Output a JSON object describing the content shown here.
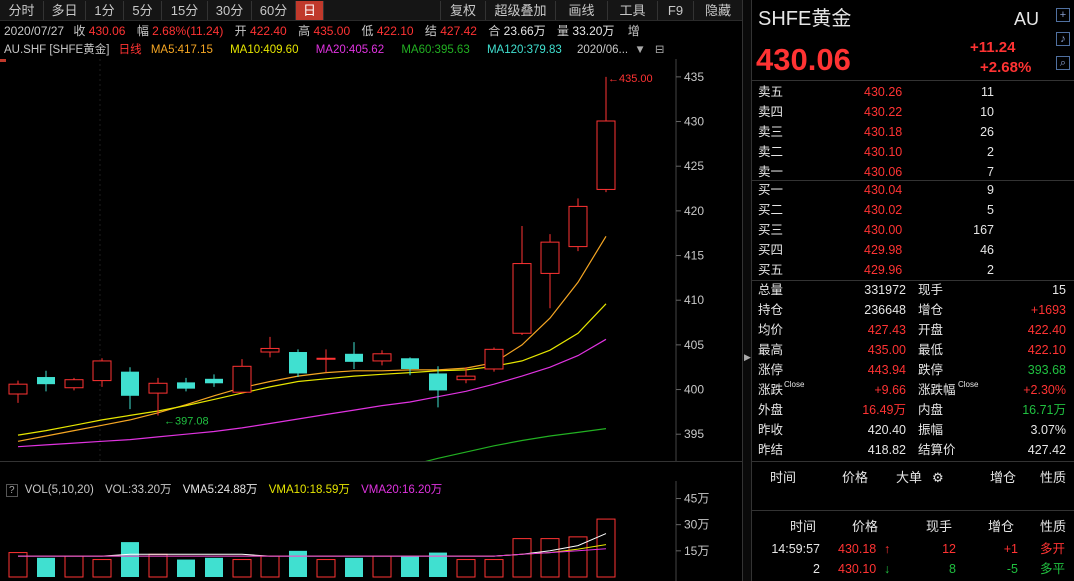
{
  "toolbar": {
    "periods": [
      "分时",
      "多日",
      "1分",
      "5分",
      "15分",
      "30分",
      "60分",
      "日"
    ],
    "active_period": "日",
    "actions": [
      "复权",
      "超级叠加",
      "画线",
      "工具",
      "F9",
      "隐藏"
    ]
  },
  "quote_line": {
    "date": "2020/07/27",
    "close_label": "收",
    "close": "430.06",
    "range_label": "幅",
    "range": "2.68%(11.24)",
    "open_label": "开",
    "open": "422.40",
    "high_label": "高",
    "high": "435.00",
    "low_label": "低",
    "low": "422.10",
    "settle_label": "结",
    "settle": "427.42",
    "oi_label": "合",
    "oi": "23.66万",
    "vol_label": "量",
    "vol": "33.20万",
    "more": "增"
  },
  "ma_line": {
    "symbol": "AU.SHF [SHFE黄金]",
    "period": "日线",
    "ma5": "MA5:417.15",
    "ma10": "MA10:409.60",
    "ma20": "MA20:405.62",
    "ma60": "MA60:395.63",
    "ma120": "MA120:379.83",
    "date_dropdown": "2020/06..."
  },
  "chart_data": [
    {
      "type": "candlestick",
      "title": "",
      "y_ticks": [
        "435",
        "430",
        "425",
        "420",
        "415",
        "410",
        "405",
        "400",
        "395"
      ],
      "ylim": [
        392,
        437
      ],
      "up_color": "#ff3333",
      "down_color": "#40e0d0",
      "annotations": {
        "max": "435.00",
        "min": "397.08"
      },
      "candles": [
        {
          "o": 399.5,
          "h": 401,
          "l": 398.5,
          "c": 400.6
        },
        {
          "o": 401.4,
          "h": 402.1,
          "l": 399.8,
          "c": 400.6
        },
        {
          "o": 400.2,
          "h": 401.3,
          "l": 399.9,
          "c": 401.1
        },
        {
          "o": 401.0,
          "h": 403.5,
          "l": 400.3,
          "c": 403.2
        },
        {
          "o": 402.0,
          "h": 402.5,
          "l": 397.8,
          "c": 399.3
        },
        {
          "o": 399.6,
          "h": 401.3,
          "l": 397.1,
          "c": 400.7
        },
        {
          "o": 400.8,
          "h": 401.3,
          "l": 399.8,
          "c": 400.1
        },
        {
          "o": 401.2,
          "h": 401.7,
          "l": 400.3,
          "c": 400.7
        },
        {
          "o": 399.7,
          "h": 403.4,
          "l": 399.6,
          "c": 402.6
        },
        {
          "o": 404.2,
          "h": 405.9,
          "l": 403.6,
          "c": 404.6
        },
        {
          "o": 404.2,
          "h": 404.5,
          "l": 401.4,
          "c": 401.8
        },
        {
          "o": 403.5,
          "h": 404.5,
          "l": 401.9,
          "c": 403.5
        },
        {
          "o": 404.0,
          "h": 405.3,
          "l": 402.3,
          "c": 403.1
        },
        {
          "o": 403.2,
          "h": 404.4,
          "l": 402.7,
          "c": 404.0
        },
        {
          "o": 403.5,
          "h": 403.6,
          "l": 401.6,
          "c": 402.3
        },
        {
          "o": 401.8,
          "h": 402.6,
          "l": 398.0,
          "c": 399.9
        },
        {
          "o": 401.1,
          "h": 402.5,
          "l": 400.7,
          "c": 401.5
        },
        {
          "o": 402.3,
          "h": 404.7,
          "l": 402.0,
          "c": 404.5
        },
        {
          "o": 406.3,
          "h": 418.3,
          "l": 406.1,
          "c": 414.1
        },
        {
          "o": 413.0,
          "h": 417.4,
          "l": 409.1,
          "c": 416.5
        },
        {
          "o": 416.0,
          "h": 421.4,
          "l": 415.5,
          "c": 420.5
        },
        {
          "o": 422.4,
          "h": 435.0,
          "l": 422.1,
          "c": 430.06
        }
      ],
      "series": [
        {
          "name": "MA5",
          "color": "#f5a623",
          "values": [
            394.2,
            394.8,
            395.4,
            396.0,
            396.6,
            397.4,
            398.3,
            399.3,
            400.2,
            400.9,
            401.5,
            401.9,
            402.1,
            402.1,
            402.2,
            402.2,
            402.4,
            403.0,
            405.0,
            408.0,
            412.0,
            417.15
          ]
        },
        {
          "name": "MA10",
          "color": "#e6e600",
          "values": [
            394.9,
            395.4,
            396.0,
            396.6,
            397.1,
            397.6,
            398.2,
            398.9,
            399.6,
            400.3,
            400.9,
            401.2,
            401.5,
            401.7,
            401.9,
            402.1,
            402.2,
            402.6,
            403.2,
            404.4,
            406.3,
            409.6
          ]
        },
        {
          "name": "MA20",
          "color": "#e033e0",
          "values": [
            393.6,
            393.8,
            394.0,
            394.2,
            394.4,
            394.7,
            395.0,
            395.3,
            395.7,
            396.2,
            396.7,
            397.2,
            397.7,
            398.2,
            398.6,
            399.2,
            399.8,
            400.6,
            401.5,
            402.5,
            403.8,
            405.62
          ]
        },
        {
          "name": "MA60",
          "color": "#22b022",
          "values": [
            null,
            null,
            null,
            null,
            null,
            null,
            null,
            null,
            null,
            null,
            null,
            null,
            null,
            null,
            391.5,
            392.3,
            393.0,
            393.7,
            394.3,
            394.8,
            395.2,
            395.63
          ]
        }
      ]
    },
    {
      "type": "bar",
      "title": "",
      "indicator": "VOL(5,10,20)",
      "vol": "VOL:33.20万",
      "vma5": "VMA5:24.88万",
      "vma10": "VMA10:18.59万",
      "vma20": "VMA20:16.20万",
      "y_ticks": [
        "45万",
        "30万",
        "15万"
      ],
      "ylim": [
        0,
        47
      ],
      "values": [
        14,
        11,
        12,
        10,
        20,
        13,
        10,
        11,
        10,
        12,
        15,
        10,
        11,
        12,
        12,
        14,
        10,
        10,
        22,
        22,
        23,
        33.2
      ],
      "series": [
        {
          "name": "VMA5",
          "color": "#ffffff",
          "values": [
            12,
            12,
            12,
            12,
            13,
            13,
            13,
            13,
            13,
            12,
            12,
            12,
            12,
            12,
            12,
            12,
            12,
            12,
            13,
            15,
            18,
            24.88
          ]
        },
        {
          "name": "VMA10",
          "color": "#e6e600",
          "values": [
            12,
            12,
            12,
            12,
            12,
            12,
            12,
            12,
            12,
            12,
            12,
            12,
            12,
            12,
            12,
            12,
            12,
            12,
            13,
            14,
            16,
            18.59
          ]
        },
        {
          "name": "VMA20",
          "color": "#e033e0",
          "values": [
            12,
            12,
            12,
            12,
            12,
            12,
            12,
            12,
            12,
            12,
            12,
            12,
            12,
            12,
            12,
            12,
            12,
            12,
            13,
            14,
            15,
            16.2
          ]
        }
      ]
    }
  ],
  "right_panel": {
    "title": "SHFE黄金",
    "code": "AU",
    "price": "430.06",
    "change": "+11.24",
    "change_pct": "+2.68%",
    "asks": [
      {
        "label": "卖五",
        "price": "430.26",
        "vol": "11"
      },
      {
        "label": "卖四",
        "price": "430.22",
        "vol": "10"
      },
      {
        "label": "卖三",
        "price": "430.18",
        "vol": "26"
      },
      {
        "label": "卖二",
        "price": "430.10",
        "vol": "2"
      },
      {
        "label": "卖一",
        "price": "430.06",
        "vol": "7"
      }
    ],
    "bids": [
      {
        "label": "买一",
        "price": "430.04",
        "vol": "9"
      },
      {
        "label": "买二",
        "price": "430.02",
        "vol": "5"
      },
      {
        "label": "买三",
        "price": "430.00",
        "vol": "167"
      },
      {
        "label": "买四",
        "price": "429.98",
        "vol": "46"
      },
      {
        "label": "买五",
        "price": "429.96",
        "vol": "2"
      }
    ],
    "stats": [
      {
        "l1": "总量",
        "v1": "331972",
        "c1": "white",
        "l2": "现手",
        "v2": "15",
        "c2": "white"
      },
      {
        "l1": "持仓",
        "v1": "236648",
        "c1": "white",
        "l2": "增仓",
        "v2": "+1693",
        "c2": "red"
      },
      {
        "l1": "均价",
        "v1": "427.43",
        "c1": "red",
        "l2": "开盘",
        "v2": "422.40",
        "c2": "red"
      },
      {
        "l1": "最高",
        "v1": "435.00",
        "c1": "red",
        "l2": "最低",
        "v2": "422.10",
        "c2": "red"
      },
      {
        "l1": "涨停",
        "v1": "443.94",
        "c1": "red",
        "l2": "跌停",
        "v2": "393.68",
        "c2": "green"
      },
      {
        "l1": "涨跌",
        "sup1": "Close",
        "v1": "+9.66",
        "c1": "red",
        "l2": "涨跌幅",
        "sup2": "Close",
        "v2": "+2.30%",
        "c2": "red"
      },
      {
        "l1": "外盘",
        "v1": "16.49万",
        "c1": "red",
        "l2": "内盘",
        "v2": "16.71万",
        "c2": "green"
      },
      {
        "l1": "昨收",
        "v1": "420.40",
        "c1": "white",
        "l2": "振幅",
        "v2": "3.07%",
        "c2": "white"
      },
      {
        "l1": "昨结",
        "v1": "418.82",
        "c1": "white",
        "l2": "结算价",
        "v2": "427.42",
        "c2": "white"
      }
    ],
    "trade_header": [
      "时间",
      "价格",
      "大单",
      "增仓",
      "性质"
    ],
    "tick_header": [
      "时间",
      "价格",
      "现手",
      "增仓",
      "性质"
    ],
    "ticks": [
      {
        "time": "14:59:57",
        "price": "430.18",
        "arrow": "↑",
        "vol": "12",
        "oi": "+1",
        "nature": "多开",
        "color": "red"
      },
      {
        "time": "2",
        "price": "430.10",
        "arrow": "↓",
        "vol": "8",
        "oi": "-5",
        "nature": "多平",
        "color": "green"
      }
    ]
  }
}
